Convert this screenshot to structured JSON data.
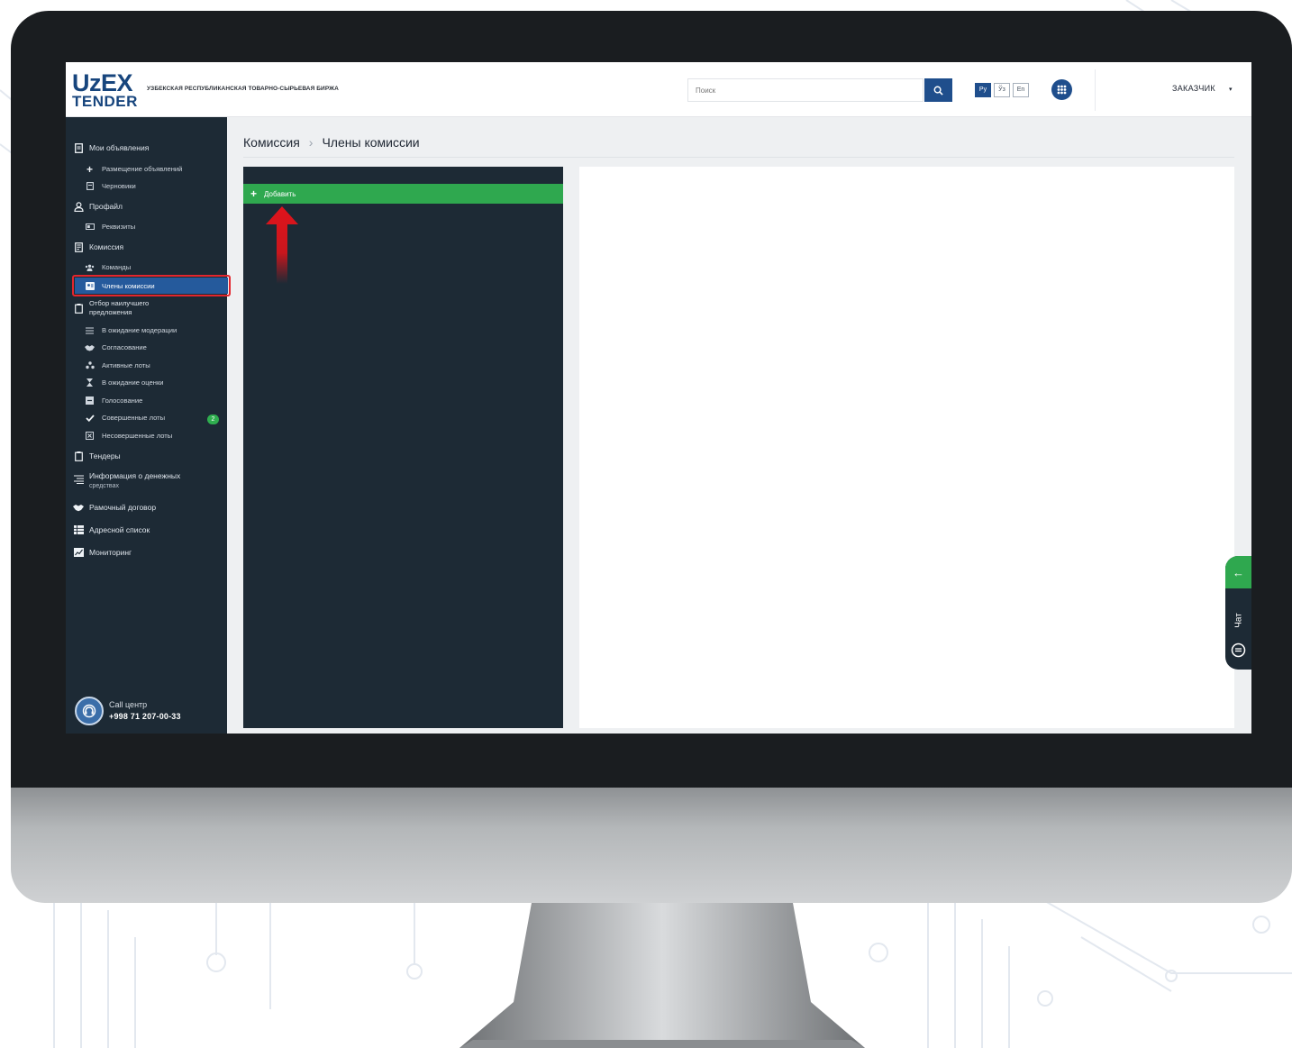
{
  "header": {
    "logo_top": "UzEX",
    "logo_bottom": "TENDER",
    "org_name": "УЗБЕКСКАЯ РЕСПУБЛИКАНСКАЯ ТОВАРНО-СЫРЬЕВАЯ БИРЖА",
    "search_placeholder": "Поиск",
    "languages": [
      "Ру",
      "Ўз",
      "En"
    ],
    "active_language": "Ру",
    "user_role": "ЗАКАЗЧИК",
    "caret": "▾"
  },
  "sidebar": {
    "items": [
      {
        "label": "Мои объявления",
        "icon": "document-icon"
      },
      {
        "label": "Размещение объявлений",
        "icon": "plus-icon"
      },
      {
        "label": "Черновики",
        "icon": "draft-icon"
      },
      {
        "label": "Профайл",
        "icon": "user-icon"
      },
      {
        "label": "Реквизиты",
        "icon": "card-icon"
      },
      {
        "label": "Комиссия",
        "icon": "commission-icon"
      },
      {
        "label": "Команды",
        "icon": "team-icon"
      },
      {
        "label": "Члены комиссии",
        "icon": "members-icon",
        "active": true
      },
      {
        "label_line1": "Отбор наилучшего",
        "label_line2": "предложения",
        "icon": "clipboard-icon"
      },
      {
        "label": "В ожидание модерации",
        "icon": "list-icon"
      },
      {
        "label": "Согласование",
        "icon": "handshake-icon"
      },
      {
        "label": "Активные лоты",
        "icon": "active-lots-icon"
      },
      {
        "label": "В ожидание оценки",
        "icon": "hourglass-icon"
      },
      {
        "label": "Голосование",
        "icon": "vote-icon"
      },
      {
        "label": "Совершенные лоты",
        "icon": "check-icon",
        "badge": "2"
      },
      {
        "label": "Несовершенные лоты",
        "icon": "cross-box-icon"
      },
      {
        "label": "Тендеры",
        "icon": "clipboard-icon"
      },
      {
        "label_line1": "Информация о денежных",
        "label_line2": "средствах",
        "icon": "money-list-icon"
      },
      {
        "label": "Рамочный договор",
        "icon": "handshake-icon"
      },
      {
        "label": "Адресной список",
        "icon": "table-icon"
      },
      {
        "label": "Мониторинг",
        "icon": "monitoring-icon"
      }
    ],
    "call_center": {
      "title": "Call центр",
      "phone": "+998 71 207-00-33"
    }
  },
  "breadcrumb": {
    "parent": "Комиссия",
    "separator": "›",
    "current": "Члены комиссии"
  },
  "left_panel": {
    "add_button": "Добавить",
    "add_icon": "+"
  },
  "chat": {
    "label": "Чат",
    "back_icon": "←"
  },
  "colors": {
    "brand_blue": "#1f4e8c",
    "sidebar_bg": "#1d2a35",
    "add_green": "#2fa84f",
    "highlight_red": "#e3262d",
    "active_row": "#255a9c"
  }
}
